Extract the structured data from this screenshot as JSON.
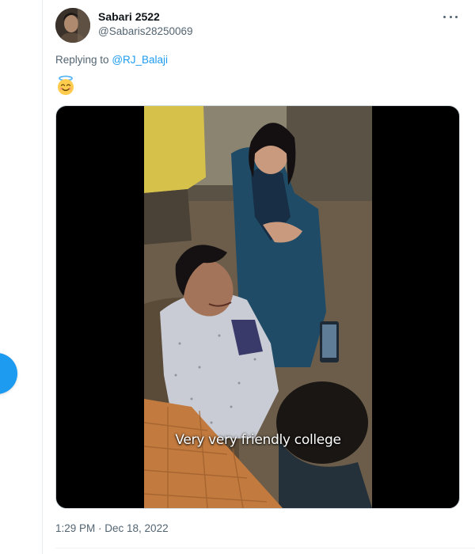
{
  "tweet": {
    "display_name": "Sabari 2522",
    "handle": "@Sabaris28250069",
    "replying_prefix": "Replying to",
    "replying_mention": "@RJ_Balaji",
    "emoji": "smiling-face-with-halo",
    "video_caption": "Very very friendly college",
    "timestamp": "1:29 PM · Dec 18, 2022"
  },
  "colors": {
    "accent": "#1d9bf0",
    "secondary_text": "#536471",
    "primary_text": "#0f1419"
  }
}
